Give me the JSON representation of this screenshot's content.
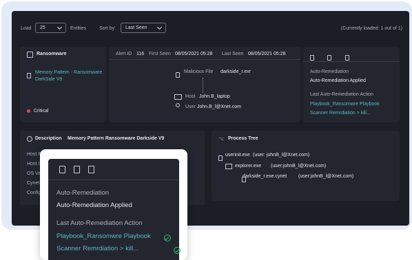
{
  "toolbar": {
    "load_label": "Load",
    "load_value": "25",
    "entities_label": "Entities",
    "sort_label": "Sort by:",
    "sort_value": "Last Seen",
    "loaded_status": "(Currently loaded: 1 out of 1)"
  },
  "threat_card": {
    "title": "Ransomware",
    "pattern_link": "Memory Pattern - Ransomware DarkSide V9",
    "severity": "Critical",
    "severity_color": "#e5484d"
  },
  "alert_card": {
    "alert_id_label": "Alert ID",
    "alert_id": "116",
    "first_seen_label": "First Seen",
    "first_seen": "08/05/2021 05:28",
    "last_seen_label": "Last Seen",
    "last_seen": "08/05/2021 05:28",
    "malicious_file_label": "Malicious File",
    "malicious_file": "darkside_r.exr",
    "host_label": "Host",
    "host": "John.B_laptop",
    "user_label": "User",
    "user": "John.B_l@Xnet.com"
  },
  "remediation_card": {
    "icons": [
      "file-icon",
      "clipboard-icon",
      "list-icon"
    ],
    "auto_rem_title": "Auto-Remediation",
    "auto_rem_value": "Auto-Remediation Applied",
    "last_action_title": "Last Auto-Remediation Action",
    "actions": [
      "Playbook_Ransomwre Playbook",
      "Scanner Remrdiation > kill..."
    ]
  },
  "description_card": {
    "label": "Description",
    "text": "Memory Pattern Ransomware Darkside V9",
    "rows": [
      "Host R",
      "Host I",
      "OS Ve",
      "Cynet",
      "Config"
    ]
  },
  "process_tree": {
    "title": "Process Tree",
    "items": [
      {
        "name": "userinit.exe",
        "user": "(user: johnB_l@Xnet.com)"
      },
      {
        "name": "explorer.exe",
        "user": "(user:johnB_l@Xnet.com)"
      },
      {
        "name": "darkside_r.exe.cynet",
        "user": "(user:johnB_l@Xnet.com)"
      }
    ]
  },
  "popup": {
    "auto_rem_title": "Auto-Remediation",
    "auto_rem_value": "Auto-Remediation Applied",
    "last_action_title": "Last Auto-Remediation Action",
    "actions": [
      "Playbook_Ransomwre Playbook",
      "Scanner Remrdiation > kill..."
    ]
  },
  "colors": {
    "accent": "#5bb7c5",
    "success": "#2fbf71",
    "background": "#1b1e25",
    "card": "#23262e"
  }
}
